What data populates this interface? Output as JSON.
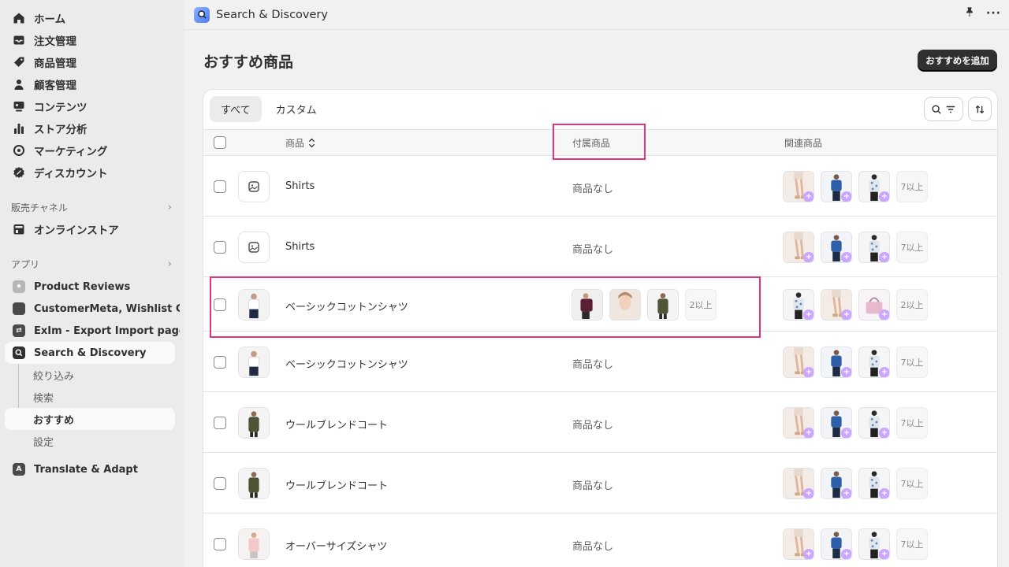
{
  "sidebar": {
    "main_items": [
      {
        "label": "ホーム",
        "icon": "home-icon"
      },
      {
        "label": "注文管理",
        "icon": "inbox-icon"
      },
      {
        "label": "商品管理",
        "icon": "tag-icon"
      },
      {
        "label": "顧客管理",
        "icon": "person-icon"
      },
      {
        "label": "コンテンツ",
        "icon": "content-icon"
      },
      {
        "label": "ストア分析",
        "icon": "bar-chart-icon"
      },
      {
        "label": "マーケティング",
        "icon": "target-icon"
      },
      {
        "label": "ディスカウント",
        "icon": "discount-icon"
      }
    ],
    "sales_channels_label": "販売チャネル",
    "online_store_label": "オンラインストア",
    "apps_label": "アプリ",
    "apps": [
      {
        "label": "Product Reviews",
        "icon": "star-icon",
        "color": "#b5b5b5"
      },
      {
        "label": "CustomerMeta, Wishlist C...",
        "icon": "app-icon",
        "color": "#4a4a4a"
      },
      {
        "label": "ExIm - Export Import pages",
        "icon": "exim-icon",
        "color": "#4a4a4a"
      },
      {
        "label": "Search & Discovery",
        "icon": "search-discovery-icon",
        "color": "#303030"
      }
    ],
    "sub_items": [
      "絞り込み",
      "検索",
      "おすすめ",
      "設定"
    ],
    "translate_label": "Translate & Adapt"
  },
  "topbar": {
    "title": "Search & Discovery"
  },
  "page": {
    "title": "おすすめ商品",
    "add_button": "おすすめを追加"
  },
  "tabs": [
    "すべて",
    "カスタム"
  ],
  "table": {
    "columns": {
      "product": "商品",
      "accessory": "付属商品",
      "related": "関連商品"
    },
    "none_label": "商品なし",
    "rows": [
      {
        "name": "Shirts",
        "thumb": "placeholder",
        "accessory": null,
        "accessory_more": "",
        "related": [
          "legs",
          "blue",
          "floral"
        ],
        "related_more": "7以上"
      },
      {
        "name": "Shirts",
        "thumb": "placeholder",
        "accessory": null,
        "accessory_more": "",
        "related": [
          "legs",
          "blue",
          "floral"
        ],
        "related_more": "7以上"
      },
      {
        "name": "ベーシックコットンシャツ",
        "thumb": "white-shirt",
        "accessory": [
          "maroon",
          "face",
          "olive"
        ],
        "accessory_more": "2以上",
        "related": [
          "floral",
          "legs",
          "bag"
        ],
        "related_more": "2以上"
      },
      {
        "name": "ベーシックコットンシャツ",
        "thumb": "white-shirt",
        "accessory": null,
        "accessory_more": "",
        "related": [
          "legs",
          "blue",
          "floral"
        ],
        "related_more": "7以上"
      },
      {
        "name": "ウールブレンドコート",
        "thumb": "olive",
        "accessory": null,
        "accessory_more": "",
        "related": [
          "legs",
          "blue",
          "floral"
        ],
        "related_more": "7以上"
      },
      {
        "name": "ウールブレンドコート",
        "thumb": "olive",
        "accessory": null,
        "accessory_more": "",
        "related": [
          "legs",
          "blue",
          "floral"
        ],
        "related_more": "7以上"
      },
      {
        "name": "オーバーサイズシャツ",
        "thumb": "pink",
        "accessory": null,
        "accessory_more": "",
        "related": [
          "legs",
          "blue",
          "floral"
        ],
        "related_more": "7以上"
      }
    ]
  },
  "colors": {
    "accent_highlight": "#e0357b",
    "primary_button": "#303030",
    "sparkle": "#c9a6ff"
  }
}
